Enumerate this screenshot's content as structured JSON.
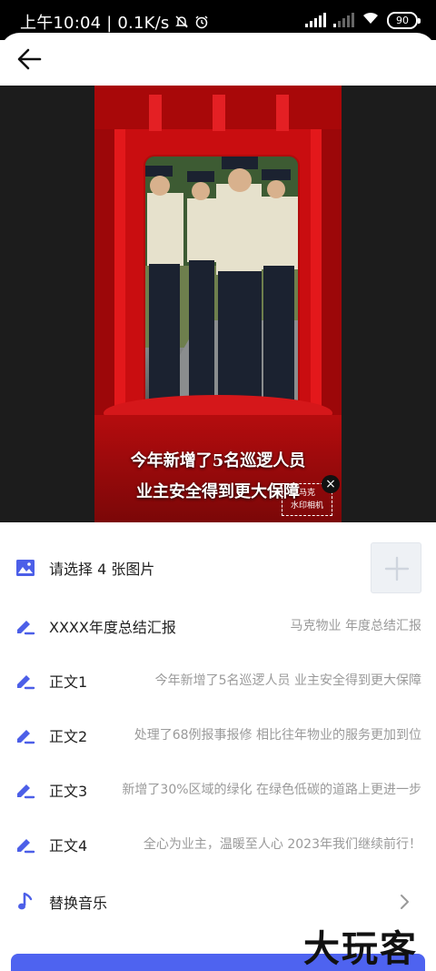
{
  "status_bar": {
    "time": "上午10:04",
    "separator": "|",
    "net_speed": "0.1K/s",
    "battery": "90"
  },
  "header": {
    "back_icon": "arrow-left-icon"
  },
  "preview": {
    "caption_line1": "今年新增了5名巡逻人员",
    "caption_line2": "业主安全得到更大保障",
    "watermark_line1": "马克",
    "watermark_line2": "水印相机",
    "close_glyph": "×"
  },
  "settings": {
    "images": {
      "label": "请选择 4 张图片",
      "icon": "image-icon",
      "add_icon": "plus-icon"
    },
    "title": {
      "label": "XXXX年度总结汇报",
      "value": "马克物业 年度总结汇报",
      "icon": "edit-icon"
    },
    "body1": {
      "label": "正文1",
      "value": "今年新增了5名巡逻人员 业主安全得到更大保障",
      "icon": "edit-icon"
    },
    "body2": {
      "label": "正文2",
      "value": "处理了68例报事报修 相比往年物业的服务更加到位",
      "icon": "edit-icon"
    },
    "body3": {
      "label": "正文3",
      "value": "新增了30%区域的绿化 在绿色低碳的道路上更进一步",
      "icon": "edit-icon"
    },
    "body4": {
      "label": "正文4",
      "value": "全心为业主，温暖至人心 2023年我们继续前行！",
      "icon": "edit-icon"
    },
    "music": {
      "label": "替换音乐",
      "icon": "music-note-icon",
      "chevron": "chevron-right-icon"
    }
  },
  "brand_watermark": "大玩客",
  "colors": {
    "accent": "#4e63f0",
    "icon": "#4c5fe8",
    "stage_red": "#c90d10"
  }
}
